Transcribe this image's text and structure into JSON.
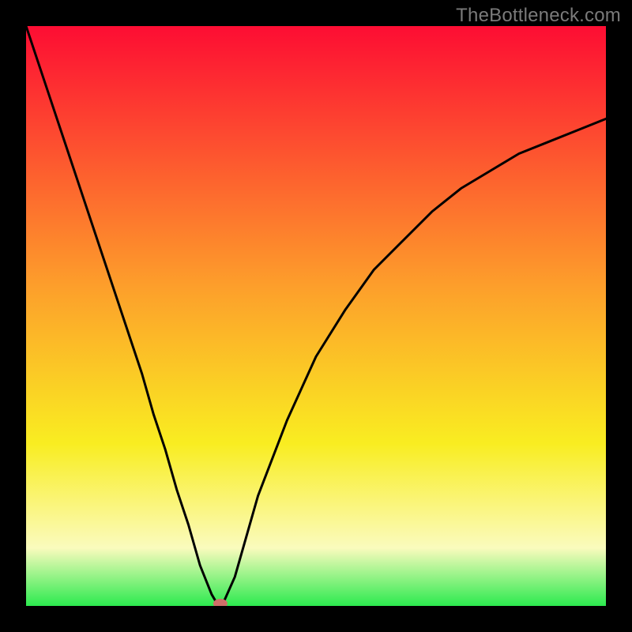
{
  "watermark": "TheBottleneck.com",
  "colors": {
    "frame": "#000000",
    "curve": "#000000",
    "marker_fill": "#cf6f69",
    "gradient_top": "#fd0d33",
    "gradient_mid1": "#fd9f2b",
    "gradient_mid2": "#f9ed21",
    "gradient_mid3": "#fafbbd",
    "gradient_bottom": "#2cea4f"
  },
  "chart_data": {
    "type": "line",
    "title": "",
    "xlabel": "",
    "ylabel": "",
    "xlim": [
      0,
      100
    ],
    "ylim": [
      0,
      100
    ],
    "x": [
      0,
      2,
      4,
      6,
      8,
      10,
      12,
      14,
      16,
      18,
      20,
      22,
      24,
      26,
      28,
      30,
      32,
      33,
      33.5,
      34,
      36,
      38,
      40,
      45,
      50,
      55,
      60,
      65,
      70,
      75,
      80,
      85,
      90,
      95,
      100
    ],
    "y": [
      100,
      94,
      88,
      82,
      76,
      70,
      64,
      58,
      52,
      46,
      40,
      33,
      27,
      20,
      14,
      7,
      2,
      0.3,
      0.0,
      0.5,
      5,
      12,
      19,
      32,
      43,
      51,
      58,
      63,
      68,
      72,
      75,
      78,
      80,
      82,
      84
    ],
    "marker": {
      "x": 33.5,
      "y": 0.0
    },
    "annotations": []
  }
}
